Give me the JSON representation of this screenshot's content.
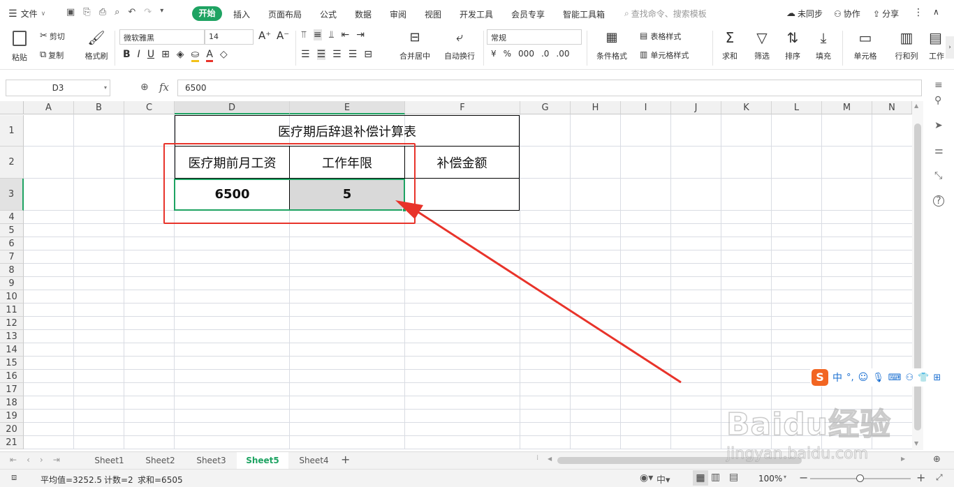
{
  "menu": {
    "file": "文件",
    "start": "开始",
    "items": [
      "插入",
      "页面布局",
      "公式",
      "数据",
      "审阅",
      "视图",
      "开发工具",
      "会员专享",
      "智能工具箱"
    ],
    "search_placeholder": "查找命令、搜索模板",
    "sync": "未同步",
    "collab": "协作",
    "share": "分享"
  },
  "ribbon": {
    "paste": "粘贴",
    "cut": "剪切",
    "copy": "复制",
    "format_painter": "格式刷",
    "font_name": "微软雅黑",
    "font_size": "14",
    "merge_center": "合并居中",
    "wrap": "自动换行",
    "number_format": "常规",
    "cond_format": "条件格式",
    "table_style": "表格样式",
    "cell_style": "单元格样式",
    "sum": "求和",
    "filter": "筛选",
    "sort": "排序",
    "fill": "填充",
    "cell": "单元格",
    "row_col": "行和列",
    "work": "工作"
  },
  "formula_bar": {
    "name_box": "D3",
    "formula": "6500"
  },
  "columns": [
    "A",
    "B",
    "C",
    "D",
    "E",
    "F",
    "G",
    "H",
    "I",
    "J",
    "K",
    "L",
    "M",
    "N"
  ],
  "rows": [
    "1",
    "2",
    "3",
    "4",
    "5",
    "6",
    "7",
    "8",
    "9",
    "10",
    "11",
    "12",
    "13",
    "14",
    "15",
    "16",
    "17",
    "18",
    "19",
    "20",
    "21"
  ],
  "sheet": {
    "title": "医疗期后辞退补偿计算表",
    "headers": [
      "医疗期前月工资",
      "工作年限",
      "补偿金额"
    ],
    "values": [
      "6500",
      "5",
      ""
    ]
  },
  "tabs": [
    "Sheet1",
    "Sheet2",
    "Sheet3",
    "Sheet5",
    "Sheet4"
  ],
  "active_tab": "Sheet5",
  "status": {
    "average": "平均值=3252.5",
    "count": "计数=2",
    "sum": "求和=6505",
    "zoom": "100%"
  },
  "ime": {
    "mode": "中"
  },
  "watermark": {
    "logo": "Baidu经验",
    "url": "jingyan.baidu.com"
  },
  "colors": {
    "accent": "#1ea362",
    "arrow": "#e8332a",
    "highlight_box": "#e8332a",
    "selected_cell_fill": "#d9d9d9"
  }
}
